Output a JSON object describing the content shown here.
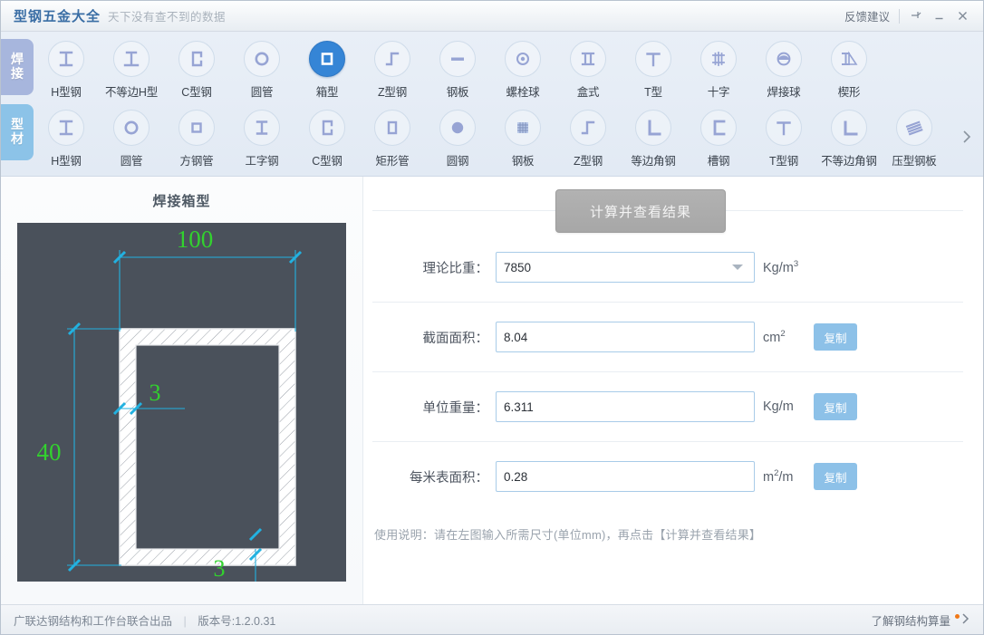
{
  "titlebar": {
    "app_title": "型钢五金大全",
    "tagline": "天下没有查不到的数据",
    "feedback": "反馈建议",
    "pin_icon": "pin-icon",
    "minimize_icon": "minimize-icon",
    "close_icon": "close-icon"
  },
  "toolbar": {
    "categories": [
      {
        "label": "焊接",
        "color": "#a7b6dd",
        "active": false
      },
      {
        "label": "型材",
        "color": "#8cc3e8",
        "active": true
      }
    ],
    "more_icon": "chevron-right-icon",
    "row1": [
      {
        "label": "H型钢",
        "icon": "h-beam-icon",
        "selected": false
      },
      {
        "label": "不等边H型",
        "icon": "unequal-h-beam-icon",
        "selected": false
      },
      {
        "label": "C型钢",
        "icon": "c-channel-icon",
        "selected": false
      },
      {
        "label": "圆管",
        "icon": "round-tube-icon",
        "selected": false
      },
      {
        "label": "箱型",
        "icon": "box-section-icon",
        "selected": true
      },
      {
        "label": "Z型钢",
        "icon": "z-section-icon",
        "selected": false
      },
      {
        "label": "钢板",
        "icon": "steel-plate-icon",
        "selected": false
      },
      {
        "label": "螺栓球",
        "icon": "bolt-ball-icon",
        "selected": false
      },
      {
        "label": "盒式",
        "icon": "box-joint-icon",
        "selected": false
      },
      {
        "label": "T型",
        "icon": "t-section-icon",
        "selected": false
      },
      {
        "label": "十字",
        "icon": "cross-section-icon",
        "selected": false
      },
      {
        "label": "焊接球",
        "icon": "welded-ball-icon",
        "selected": false
      },
      {
        "label": "楔形",
        "icon": "wedge-icon",
        "selected": false
      }
    ],
    "row2": [
      {
        "label": "H型钢",
        "icon": "h-beam-icon",
        "selected": false
      },
      {
        "label": "圆管",
        "icon": "round-tube-icon",
        "selected": false
      },
      {
        "label": "方钢管",
        "icon": "square-tube-icon",
        "selected": false
      },
      {
        "label": "工字钢",
        "icon": "i-beam-icon",
        "selected": false
      },
      {
        "label": "C型钢",
        "icon": "c-channel-icon",
        "selected": false
      },
      {
        "label": "矩形管",
        "icon": "rect-tube-icon",
        "selected": false
      },
      {
        "label": "圆钢",
        "icon": "round-bar-icon",
        "selected": false
      },
      {
        "label": "钢板",
        "icon": "steel-plate-textured-icon",
        "selected": false
      },
      {
        "label": "Z型钢",
        "icon": "z-section-icon",
        "selected": false
      },
      {
        "label": "等边角钢",
        "icon": "equal-angle-icon",
        "selected": false
      },
      {
        "label": "槽钢",
        "icon": "channel-icon",
        "selected": false
      },
      {
        "label": "T型钢",
        "icon": "t-section-icon",
        "selected": false
      },
      {
        "label": "不等边角钢",
        "icon": "unequal-angle-icon",
        "selected": false
      },
      {
        "label": "压型钢板",
        "icon": "corrugated-plate-icon",
        "selected": false
      }
    ]
  },
  "diagram": {
    "title": "焊接箱型",
    "background": "#4a515b",
    "dim_color": "#32d22e",
    "line_color": "#22b1e0",
    "dimensions": {
      "width": "100",
      "height": "40",
      "thickness_top": "3",
      "thickness_bottom": "3"
    }
  },
  "calc": {
    "button_label": "计算并查看结果",
    "fields": [
      {
        "label": "理论比重：",
        "value": "7850",
        "unit_text": "Kg/m",
        "unit_sup": "3",
        "type": "dropdown",
        "copy": null
      },
      {
        "label": "截面面积：",
        "value": "8.04",
        "unit_text": "cm",
        "unit_sup": "2",
        "type": "text",
        "copy": "复制"
      },
      {
        "label": "单位重量：",
        "value": "6.311",
        "unit_text": "Kg/m",
        "unit_sup": "",
        "type": "text",
        "copy": "复制"
      },
      {
        "label": "每米表面积：",
        "value": "0.28",
        "unit_text_pre": "m",
        "unit_sup": "2",
        "unit_text_post": "/m",
        "unit_text": "m",
        "type": "text",
        "copy": "复制"
      }
    ],
    "hint": "使用说明：请在左图输入所需尺寸(单位mm)，再点击【计算并查看结果】"
  },
  "footer": {
    "producer": "广联达钢结构和工作台联合出品",
    "separator": "|",
    "version": "版本号:1.2.0.31",
    "link": "了解钢结构算量",
    "link_icon": "chevron-right-icon"
  }
}
